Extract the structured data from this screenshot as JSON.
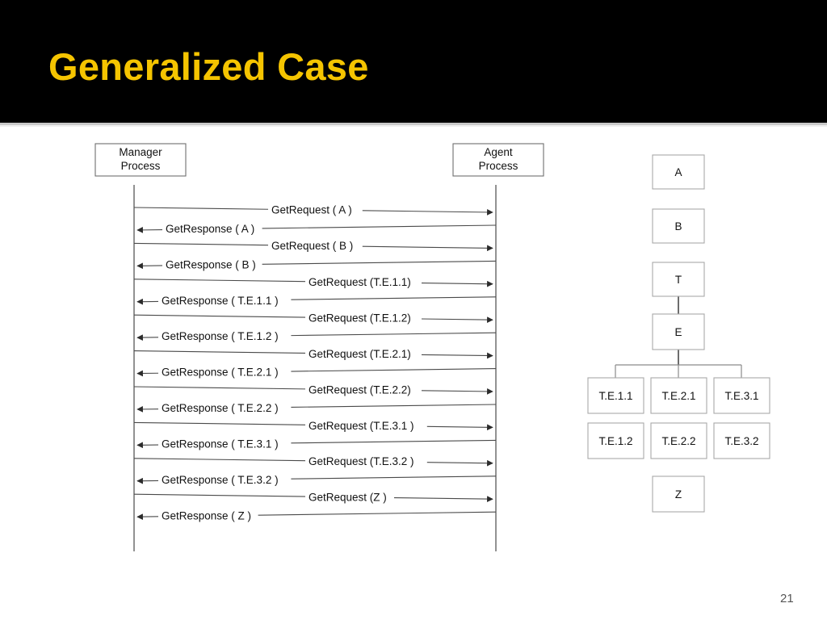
{
  "slide": {
    "title": "Generalized Case",
    "page_number": "21",
    "title_color": "#F5C400",
    "header_bg": "#000000",
    "body_bg": "#FFFFFF"
  },
  "sequence_diagram": {
    "manager": {
      "title_line1": "Manager",
      "title_line2": "Process"
    },
    "agent": {
      "title_line1": "Agent",
      "title_line2": "Process"
    },
    "messages": [
      {
        "label": "GetRequest ( A )",
        "direction": "request"
      },
      {
        "label": "GetResponse ( A )",
        "direction": "response"
      },
      {
        "label": "GetRequest ( B )",
        "direction": "request"
      },
      {
        "label": "GetResponse ( B )",
        "direction": "response"
      },
      {
        "label": "GetRequest (T.E.1.1)",
        "direction": "request"
      },
      {
        "label": "GetResponse ( T.E.1.1 )",
        "direction": "response"
      },
      {
        "label": "GetRequest (T.E.1.2)",
        "direction": "request"
      },
      {
        "label": "GetResponse ( T.E.1.2 )",
        "direction": "response"
      },
      {
        "label": "GetRequest (T.E.2.1)",
        "direction": "request"
      },
      {
        "label": "GetResponse ( T.E.2.1 )",
        "direction": "response"
      },
      {
        "label": "GetRequest (T.E.2.2)",
        "direction": "request"
      },
      {
        "label": "GetResponse ( T.E.2.2 )",
        "direction": "response"
      },
      {
        "label": "GetRequest (T.E.3.1 )",
        "direction": "request"
      },
      {
        "label": "GetResponse ( T.E.3.1 )",
        "direction": "response"
      },
      {
        "label": "GetRequest (T.E.3.2 )",
        "direction": "request"
      },
      {
        "label": "GetResponse ( T.E.3.2 )",
        "direction": "response"
      },
      {
        "label": "GetRequest (Z )",
        "direction": "request"
      },
      {
        "label": "GetResponse ( Z )",
        "direction": "response"
      }
    ]
  },
  "mib_tree": {
    "nodes": [
      {
        "id": "a",
        "label": "A"
      },
      {
        "id": "b",
        "label": "B"
      },
      {
        "id": "t",
        "label": "T"
      },
      {
        "id": "e",
        "label": "E"
      },
      {
        "id": "te11",
        "label": "T.E.1.1"
      },
      {
        "id": "te21",
        "label": "T.E.2.1"
      },
      {
        "id": "te31",
        "label": "T.E.3.1"
      },
      {
        "id": "te12",
        "label": "T.E.1.2"
      },
      {
        "id": "te22",
        "label": "T.E.2.2"
      },
      {
        "id": "te32",
        "label": "T.E.3.2"
      },
      {
        "id": "z",
        "label": "Z"
      }
    ]
  }
}
